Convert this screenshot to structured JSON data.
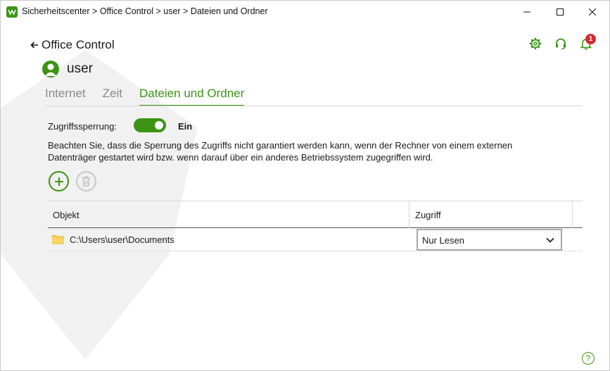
{
  "window": {
    "title": "Sicherheitscenter > Office Control > user > Dateien und Ordner",
    "controls": [
      "minimize-icon",
      "maximize-icon",
      "close-icon"
    ]
  },
  "colors": {
    "accent": "#3c9314",
    "badge": "#d9272e"
  },
  "header": {
    "back_label": "Office Control",
    "user_name": "user",
    "notification_count": "1",
    "icons": [
      "gear-icon",
      "headset-icon",
      "bell-icon"
    ]
  },
  "tabs": [
    {
      "label": "Internet",
      "active": false
    },
    {
      "label": "Zeit",
      "active": false
    },
    {
      "label": "Dateien und Ordner",
      "active": true
    }
  ],
  "access_lock": {
    "label": "Zugriffssperrung:",
    "state_text": "Ein",
    "enabled": true
  },
  "notice": "Beachten Sie, dass die Sperrung des Zugriffs nicht garantiert werden kann, wenn der Rechner von einem externen Datenträger gestartet wird bzw. wenn darauf über ein anderes Betriebssystem zugegriffen wird.",
  "table": {
    "columns": [
      "Objekt",
      "Zugriff"
    ],
    "rows": [
      {
        "object": "C:\\Users\\user\\Documents",
        "access": "Nur Lesen"
      }
    ]
  },
  "help_label": "?"
}
